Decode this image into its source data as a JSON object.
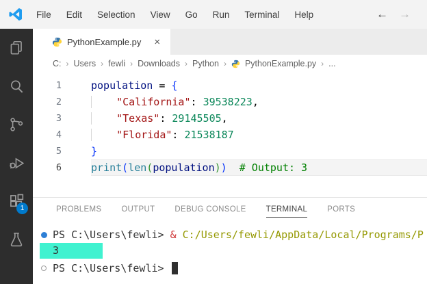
{
  "titlebar": {
    "menus": [
      "File",
      "Edit",
      "Selection",
      "View",
      "Go",
      "Run",
      "Terminal",
      "Help"
    ],
    "nav_back": "←",
    "nav_forward": "→"
  },
  "activity_bar": {
    "items": [
      "explorer",
      "search",
      "source-control",
      "run-and-debug",
      "extensions",
      "testing"
    ],
    "extensions_badge": "1"
  },
  "tab": {
    "label": "PythonExample.py",
    "close": "×"
  },
  "breadcrumb": {
    "items": [
      {
        "label": "C:"
      },
      {
        "label": "Users"
      },
      {
        "label": "fewli"
      },
      {
        "label": "Downloads"
      },
      {
        "label": "Python"
      },
      {
        "label": "PythonExample.py",
        "icon": "python"
      },
      {
        "label": "..."
      }
    ],
    "separator": "›"
  },
  "editor": {
    "lines": [
      {
        "num": "1",
        "tokens": [
          {
            "t": "population",
            "c": "variable"
          },
          {
            "t": " = ",
            "c": "default"
          },
          {
            "t": "{",
            "c": "bracket1"
          }
        ]
      },
      {
        "num": "2",
        "tokens": [
          {
            "t": "    ",
            "c": "default",
            "guide": true
          },
          {
            "t": "\"California\"",
            "c": "string"
          },
          {
            "t": ": ",
            "c": "default"
          },
          {
            "t": "39538223",
            "c": "number"
          },
          {
            "t": ",",
            "c": "default"
          }
        ]
      },
      {
        "num": "3",
        "tokens": [
          {
            "t": "    ",
            "c": "default",
            "guide": true
          },
          {
            "t": "\"Texas\"",
            "c": "string"
          },
          {
            "t": ": ",
            "c": "default"
          },
          {
            "t": "29145505",
            "c": "number"
          },
          {
            "t": ",",
            "c": "default"
          }
        ]
      },
      {
        "num": "4",
        "tokens": [
          {
            "t": "    ",
            "c": "default",
            "guide": true
          },
          {
            "t": "\"Florida\"",
            "c": "string"
          },
          {
            "t": ": ",
            "c": "default"
          },
          {
            "t": "21538187",
            "c": "number"
          }
        ]
      },
      {
        "num": "5",
        "tokens": [
          {
            "t": "}",
            "c": "bracket1"
          }
        ]
      },
      {
        "num": "6",
        "current": true,
        "tokens": [
          {
            "t": "print",
            "c": "function"
          },
          {
            "t": "(",
            "c": "bracket1"
          },
          {
            "t": "len",
            "c": "function"
          },
          {
            "t": "(",
            "c": "bracket2"
          },
          {
            "t": "population",
            "c": "variable"
          },
          {
            "t": ")",
            "c": "bracket2"
          },
          {
            "t": ")",
            "c": "bracket1"
          },
          {
            "t": "  ",
            "c": "default"
          },
          {
            "t": "# Output: 3",
            "c": "comment"
          }
        ]
      }
    ]
  },
  "panel": {
    "tabs": [
      {
        "label": "PROBLEMS"
      },
      {
        "label": "OUTPUT"
      },
      {
        "label": "DEBUG CONSOLE"
      },
      {
        "label": "TERMINAL",
        "active": true
      },
      {
        "label": "PORTS"
      }
    ]
  },
  "terminal": {
    "lines": [
      {
        "decoration": "filled",
        "tokens": [
          {
            "t": "PS C:\\Users\\fewli> ",
            "c": "prompt"
          },
          {
            "t": "& ",
            "c": "operator"
          },
          {
            "t": "C:/Users/fewli/AppData/Local/Programs/P",
            "c": "path"
          }
        ]
      },
      {
        "selected": true,
        "tokens": [
          {
            "t": "3",
            "c": "prompt"
          }
        ]
      },
      {
        "decoration": "hollow",
        "cursor": true,
        "gap": true,
        "tokens": [
          {
            "t": "PS C:\\Users\\fewli> ",
            "c": "prompt"
          }
        ]
      }
    ]
  },
  "colors": {
    "accent": "#007acc",
    "selection": "#40f2d0",
    "syntax": {
      "default": "#000000",
      "variable": "#001080",
      "string": "#a31515",
      "number": "#098658",
      "function": "#267f99",
      "comment": "#008000",
      "bracket1": "#0431fa",
      "bracket2": "#319331"
    },
    "terminal_tokens": {
      "prompt": "#333333",
      "operator": "#cd3131",
      "path": "#949800"
    }
  }
}
